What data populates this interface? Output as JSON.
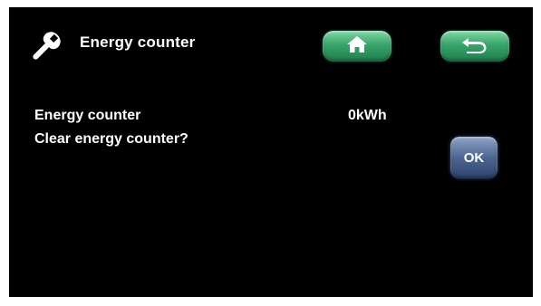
{
  "header": {
    "title": "Energy counter",
    "icon": "wrench-icon",
    "home_icon": "home-icon",
    "back_icon": "back-arrow-icon"
  },
  "content": {
    "energy_counter_label": "Energy counter",
    "energy_counter_value": "0kWh",
    "clear_prompt": "Clear energy counter?",
    "ok_label": "OK"
  },
  "colors": {
    "background": "#000000",
    "text": "#ffffff",
    "nav_button": "#38a56a",
    "ok_button": "#4d6592"
  }
}
